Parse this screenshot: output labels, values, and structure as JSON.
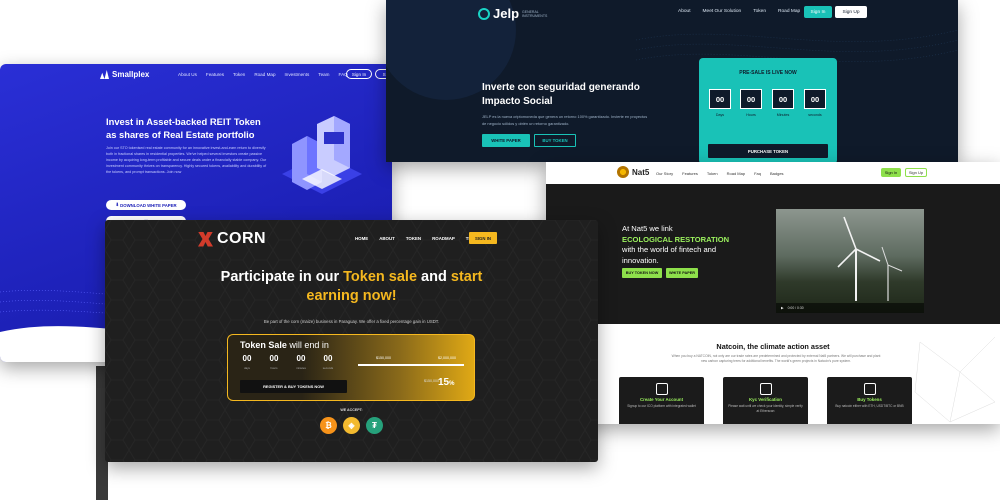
{
  "smallplex": {
    "logo": "Smallplex",
    "nav": [
      "About Us",
      "Features",
      "Token",
      "Road Map",
      "Investments",
      "Team",
      "FAQ"
    ],
    "sign_in": "Sign In",
    "sign_up": "Sig",
    "headline": "Invest in Asset-backed REIT Token as shares of Real Estate portfolio",
    "body": "Join our STO tokenised real estate community for an innovative invest-and-earn return to diversify both in fractional shares in residential properties. We've helped several investors create passive income by acquiring long-term profitable and secure deals under a financially stable company. Our investment community thrives on transparency. Highly secured tokens, availability and durability of the tokens, and prompt transactions. Join now",
    "whitepaper_button": "DOWNLOAD WHITE PAPER",
    "colors": {
      "bg": "#2a2fd6"
    }
  },
  "jelp": {
    "logo": "Jelp",
    "logo_sub": "GENERAL INSTRUMENTS",
    "nav": [
      "About",
      "Meet Our Solution",
      "Token",
      "Road Map"
    ],
    "sign_in": "Sign In",
    "sign_up": "Sign Up",
    "headline": "Inverte con seguridad generando Impacto Social",
    "body": "JELP es la nueva criptomoneda que genera un retorno 100% garantizado. Invierte en proyectos de negocio sólidos y obtén un retorno garantizado.",
    "white_paper": "WHITE PAPER",
    "buy_token": "BUY TOKEN",
    "presale_title": "PRE-SALE IS LIVE NOW",
    "countdown": [
      {
        "value": "00",
        "label": "Days"
      },
      {
        "value": "00",
        "label": "Hours"
      },
      {
        "value": "00",
        "label": "Minutes"
      },
      {
        "value": "00",
        "label": "seconds"
      }
    ],
    "purchase": "PURCHASE TOKEN",
    "colors": {
      "accent": "#19c2b7",
      "bg": "#0f1a2a"
    }
  },
  "nat5": {
    "logo": "Nat5",
    "nav": [
      "Our Story",
      "Features",
      "Token",
      "Road Map",
      "Faq",
      "Badges"
    ],
    "sign_in": "Sign In",
    "sign_up": "Sign Up",
    "hero_pre": "At Nat5 we link",
    "hero_highlight": "ECOLOGICAL RESTORATION",
    "hero_post": "with the world of fintech and innovation.",
    "buy_button": "BUY TOKEN NOW",
    "paper_button": "WHITE PAPER",
    "video_time": "0:00 / 0:30",
    "section_title": "Natcoin, the climate action asset",
    "section_text": "When you buy a NATCOIN, not only are our trade rates are predetermined and protected by external Nat5 partners. We will purchase and plant new carbon capturing trees for additional benefits. The world's green projects in Natcoin's pure system.",
    "features": [
      {
        "title": "Create Your Account",
        "desc": "Signup to our ICO platform with integrated wallet"
      },
      {
        "title": "Kyc Verification",
        "desc": "Please wait until we check your identity, simple verify at Etherscan"
      },
      {
        "title": "Buy Tokens",
        "desc": "Buy natcoin either with ETH, USDT/BTC or BNB"
      }
    ],
    "colors": {
      "accent": "#8ee04b"
    }
  },
  "corn": {
    "logo": "CORN",
    "nav": [
      "HOME",
      "ABOUT",
      "TOKEN",
      "ROADMAP",
      "TEAM"
    ],
    "sign_in": "SIGN IN",
    "headline_a": "Participate in our ",
    "headline_b": "Token sale",
    "headline_c": " and ",
    "headline_d": "start",
    "headline_e": "earning now!",
    "tagline": "Be part of the corn (maize) business in Paraguay. We offer a fixed percentage gain in USDT.",
    "sale_a": "Token Sale",
    "sale_b": " will end in",
    "countdown": [
      {
        "value": "00",
        "label": "days"
      },
      {
        "value": "00",
        "label": "hours"
      },
      {
        "value": "00",
        "label": "minutes"
      },
      {
        "value": "00",
        "label": "seconds"
      }
    ],
    "register": "REGISTER & BUY TOKENS NOW",
    "softcap": "$150,000",
    "hardcap": "$2,000,000",
    "raised": "$150,000",
    "bonus": "15",
    "pct_sign": "%",
    "we_accept": "WE ACCEPT:",
    "coins": [
      {
        "symbol": "₿",
        "color": "#f7931a"
      },
      {
        "symbol": "◈",
        "color": "#f3ba2f"
      },
      {
        "symbol": "₮",
        "color": "#26a17b"
      }
    ],
    "colors": {
      "accent": "#f5b81f",
      "logo_mark": "#d23b2b"
    }
  }
}
